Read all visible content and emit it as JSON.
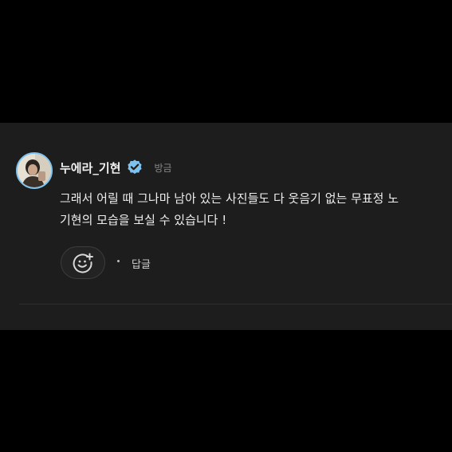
{
  "comment": {
    "username": "누에라_기현",
    "timestamp": "방금",
    "text": "그래서 어릴 때 그나마 남아 있는 사진들도 다 웃음기 없는 무표정 노\n기현의 모습을 보실 수 있습니다 !",
    "verified": true,
    "reply_label": "답글"
  },
  "icons": {
    "verified": "verified-check-badge-icon",
    "react": "add-reaction-smiley-icon"
  },
  "colors": {
    "background": "#000000",
    "panel": "#1d1d1d",
    "verified_badge": "#7ec3f0",
    "avatar_ring": "#7ec3f0",
    "text": "#eeeeee",
    "muted": "#8a8a8a"
  }
}
